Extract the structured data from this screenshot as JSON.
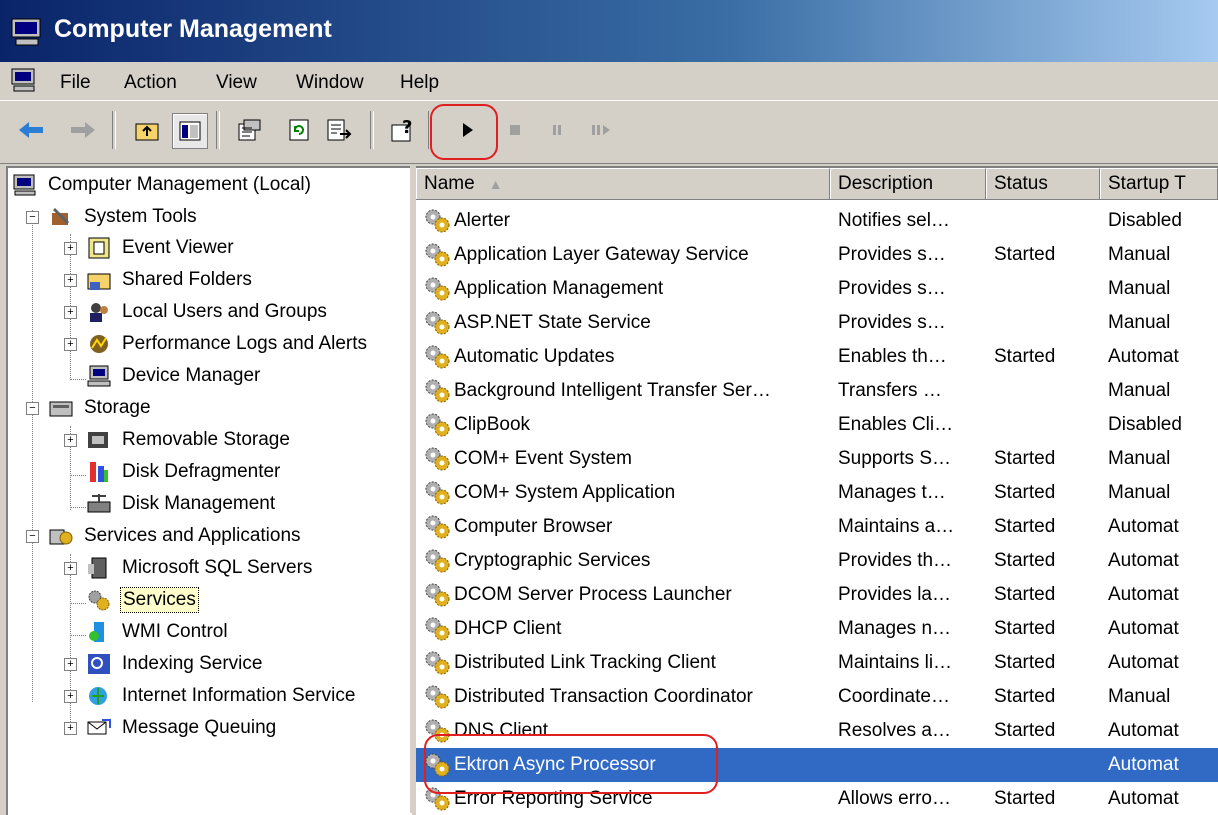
{
  "window": {
    "title": "Computer Management"
  },
  "menu": [
    "File",
    "Action",
    "View",
    "Window",
    "Help"
  ],
  "toolbar": {
    "buttons": [
      "back-icon",
      "forward-icon",
      "up-folder-icon",
      "show-hide-tree-icon",
      "properties-icon",
      "refresh-icon",
      "export-list-icon",
      "help-icon",
      "start-icon",
      "stop-icon",
      "pause-icon",
      "restart-icon"
    ]
  },
  "tree": {
    "root": "Computer Management (Local)",
    "system_tools": "System Tools",
    "event_viewer": "Event Viewer",
    "shared_folders": "Shared Folders",
    "local_users": "Local Users and Groups",
    "perf_logs": "Performance Logs and Alerts",
    "device_manager": "Device Manager",
    "storage": "Storage",
    "removable_storage": "Removable Storage",
    "disk_defrag": "Disk Defragmenter",
    "disk_mgmt": "Disk Management",
    "services_apps": "Services and Applications",
    "sql_servers": "Microsoft SQL Servers",
    "services": "Services",
    "wmi": "WMI Control",
    "indexing": "Indexing Service",
    "iis": "Internet Information Service",
    "msmq": "Message Queuing"
  },
  "list": {
    "columns": [
      "Name",
      "Description",
      "Status",
      "Startup T"
    ],
    "rows": [
      {
        "name": "Alerter",
        "description": "Notifies sel…",
        "status": "",
        "startup": "Disabled"
      },
      {
        "name": "Application Layer Gateway Service",
        "description": "Provides s…",
        "status": "Started",
        "startup": "Manual"
      },
      {
        "name": "Application Management",
        "description": "Provides s…",
        "status": "",
        "startup": "Manual"
      },
      {
        "name": "ASP.NET State Service",
        "description": "Provides s…",
        "status": "",
        "startup": "Manual"
      },
      {
        "name": "Automatic Updates",
        "description": "Enables th…",
        "status": "Started",
        "startup": "Automat"
      },
      {
        "name": "Background Intelligent Transfer Ser…",
        "description": "Transfers …",
        "status": "",
        "startup": "Manual"
      },
      {
        "name": "ClipBook",
        "description": "Enables Cli…",
        "status": "",
        "startup": "Disabled"
      },
      {
        "name": "COM+ Event System",
        "description": "Supports S…",
        "status": "Started",
        "startup": "Manual"
      },
      {
        "name": "COM+ System Application",
        "description": "Manages t…",
        "status": "Started",
        "startup": "Manual"
      },
      {
        "name": "Computer Browser",
        "description": "Maintains a…",
        "status": "Started",
        "startup": "Automat"
      },
      {
        "name": "Cryptographic Services",
        "description": "Provides th…",
        "status": "Started",
        "startup": "Automat"
      },
      {
        "name": "DCOM Server Process Launcher",
        "description": "Provides la…",
        "status": "Started",
        "startup": "Automat"
      },
      {
        "name": "DHCP Client",
        "description": "Manages n…",
        "status": "Started",
        "startup": "Automat"
      },
      {
        "name": "Distributed Link Tracking Client",
        "description": "Maintains li…",
        "status": "Started",
        "startup": "Automat"
      },
      {
        "name": "Distributed Transaction Coordinator",
        "description": "Coordinate…",
        "status": "Started",
        "startup": "Manual"
      },
      {
        "name": "DNS Client",
        "description": "Resolves a…",
        "status": "Started",
        "startup": "Automat"
      },
      {
        "name": "Ektron Async Processor",
        "description": "",
        "status": "",
        "startup": "Automat",
        "selected": true
      },
      {
        "name": "Error Reporting Service",
        "description": "Allows erro…",
        "status": "Started",
        "startup": "Automat"
      }
    ]
  },
  "colors": {
    "title_start": "#0a246a",
    "title_end": "#a6caf0",
    "selection": "#316ac5",
    "highlight_oval": "#e02020"
  }
}
